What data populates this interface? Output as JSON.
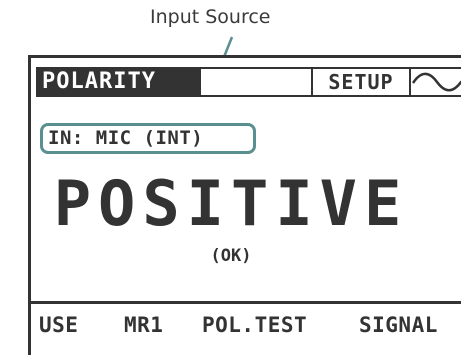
{
  "callout": {
    "label": "Input Source"
  },
  "lcd": {
    "tabs": {
      "polarity": "POLARITY",
      "setup": "SETUP",
      "waveform_icon": "sine-wave-icon"
    },
    "input_source": "IN: MIC (INT)",
    "result": "POSITIVE",
    "status": "(OK)",
    "softkeys": [
      "USE",
      "MR1",
      "POL.TEST",
      "SIGNAL"
    ]
  },
  "colors": {
    "lcd_ink": "#333333",
    "callout_accent": "#5a8f90",
    "background": "#ffffff"
  }
}
